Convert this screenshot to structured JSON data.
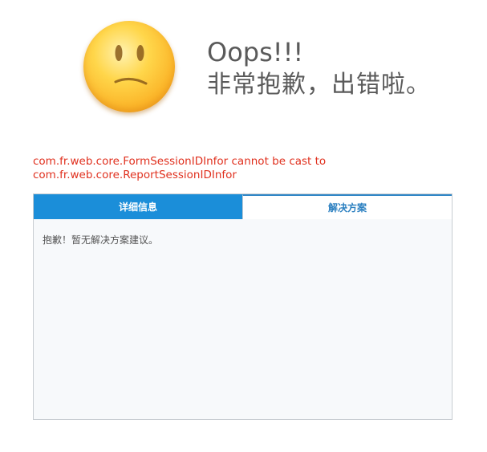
{
  "header": {
    "title": "Oops!!!",
    "subtitle": "非常抱歉，出错啦。"
  },
  "error": {
    "line1": "com.fr.web.core.FormSessionIDInfor cannot be cast to",
    "line2": "com.fr.web.core.ReportSessionIDInfor",
    "color": "#e0301e"
  },
  "tabs": [
    {
      "label": "详细信息",
      "active": true
    },
    {
      "label": "解决方案",
      "active": false
    }
  ],
  "panel": {
    "content": "抱歉！暂无解决方案建议。"
  },
  "colors": {
    "accent": "#1b8ed9",
    "face": "#ffd64a"
  }
}
